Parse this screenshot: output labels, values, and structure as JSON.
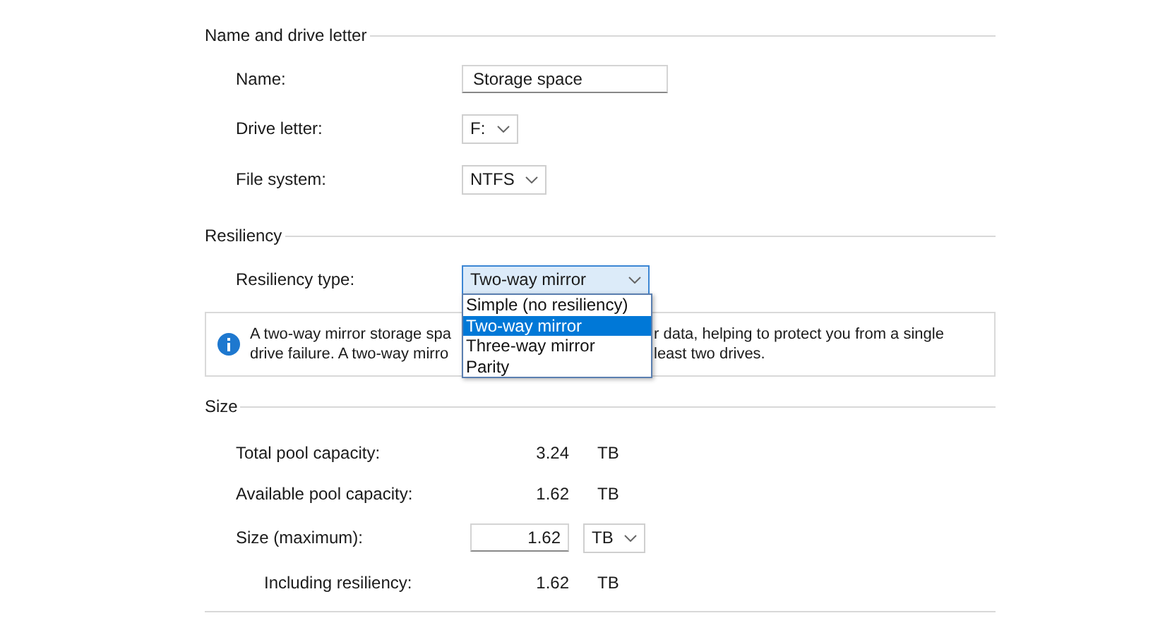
{
  "sections": [
    {
      "title": "Name and drive letter",
      "rows": [
        {
          "kind": "text_field",
          "label": "Name:",
          "value": "Storage space"
        },
        {
          "kind": "select",
          "label": "Drive letter:",
          "value": "F:"
        },
        {
          "kind": "select",
          "label": "File system:",
          "value": "NTFS"
        }
      ]
    },
    {
      "title": "Resiliency",
      "rows": [
        {
          "kind": "dropdown",
          "label": "Resiliency type:",
          "value": "Two-way mirror",
          "expanded": true,
          "options": [
            {
              "label": "Simple (no resiliency)",
              "selected": false
            },
            {
              "label": "Two-way mirror",
              "selected": true
            },
            {
              "label": "Three-way mirror",
              "selected": false
            },
            {
              "label": "Parity",
              "selected": false
            }
          ]
        },
        {
          "kind": "info",
          "lines": [
            [
              "A two-way mirror storage spa",
              "r data, helping to protect you from a single"
            ],
            [
              "drive failure. A two-way mirro",
              "least two drives."
            ]
          ]
        }
      ]
    },
    {
      "title": "Size",
      "rows": [
        {
          "kind": "reading",
          "label": "Total pool capacity:",
          "value": "3.24",
          "unit": "TB",
          "indented": false
        },
        {
          "kind": "reading",
          "label": "Available pool capacity:",
          "value": "1.62",
          "unit": "TB",
          "indented": false
        },
        {
          "kind": "number_field",
          "label": "Size (maximum):",
          "value": "1.62",
          "unit": "TB"
        },
        {
          "kind": "reading",
          "label": "Including resiliency:",
          "value": "1.62",
          "unit": "TB",
          "indented": true
        }
      ]
    }
  ]
}
